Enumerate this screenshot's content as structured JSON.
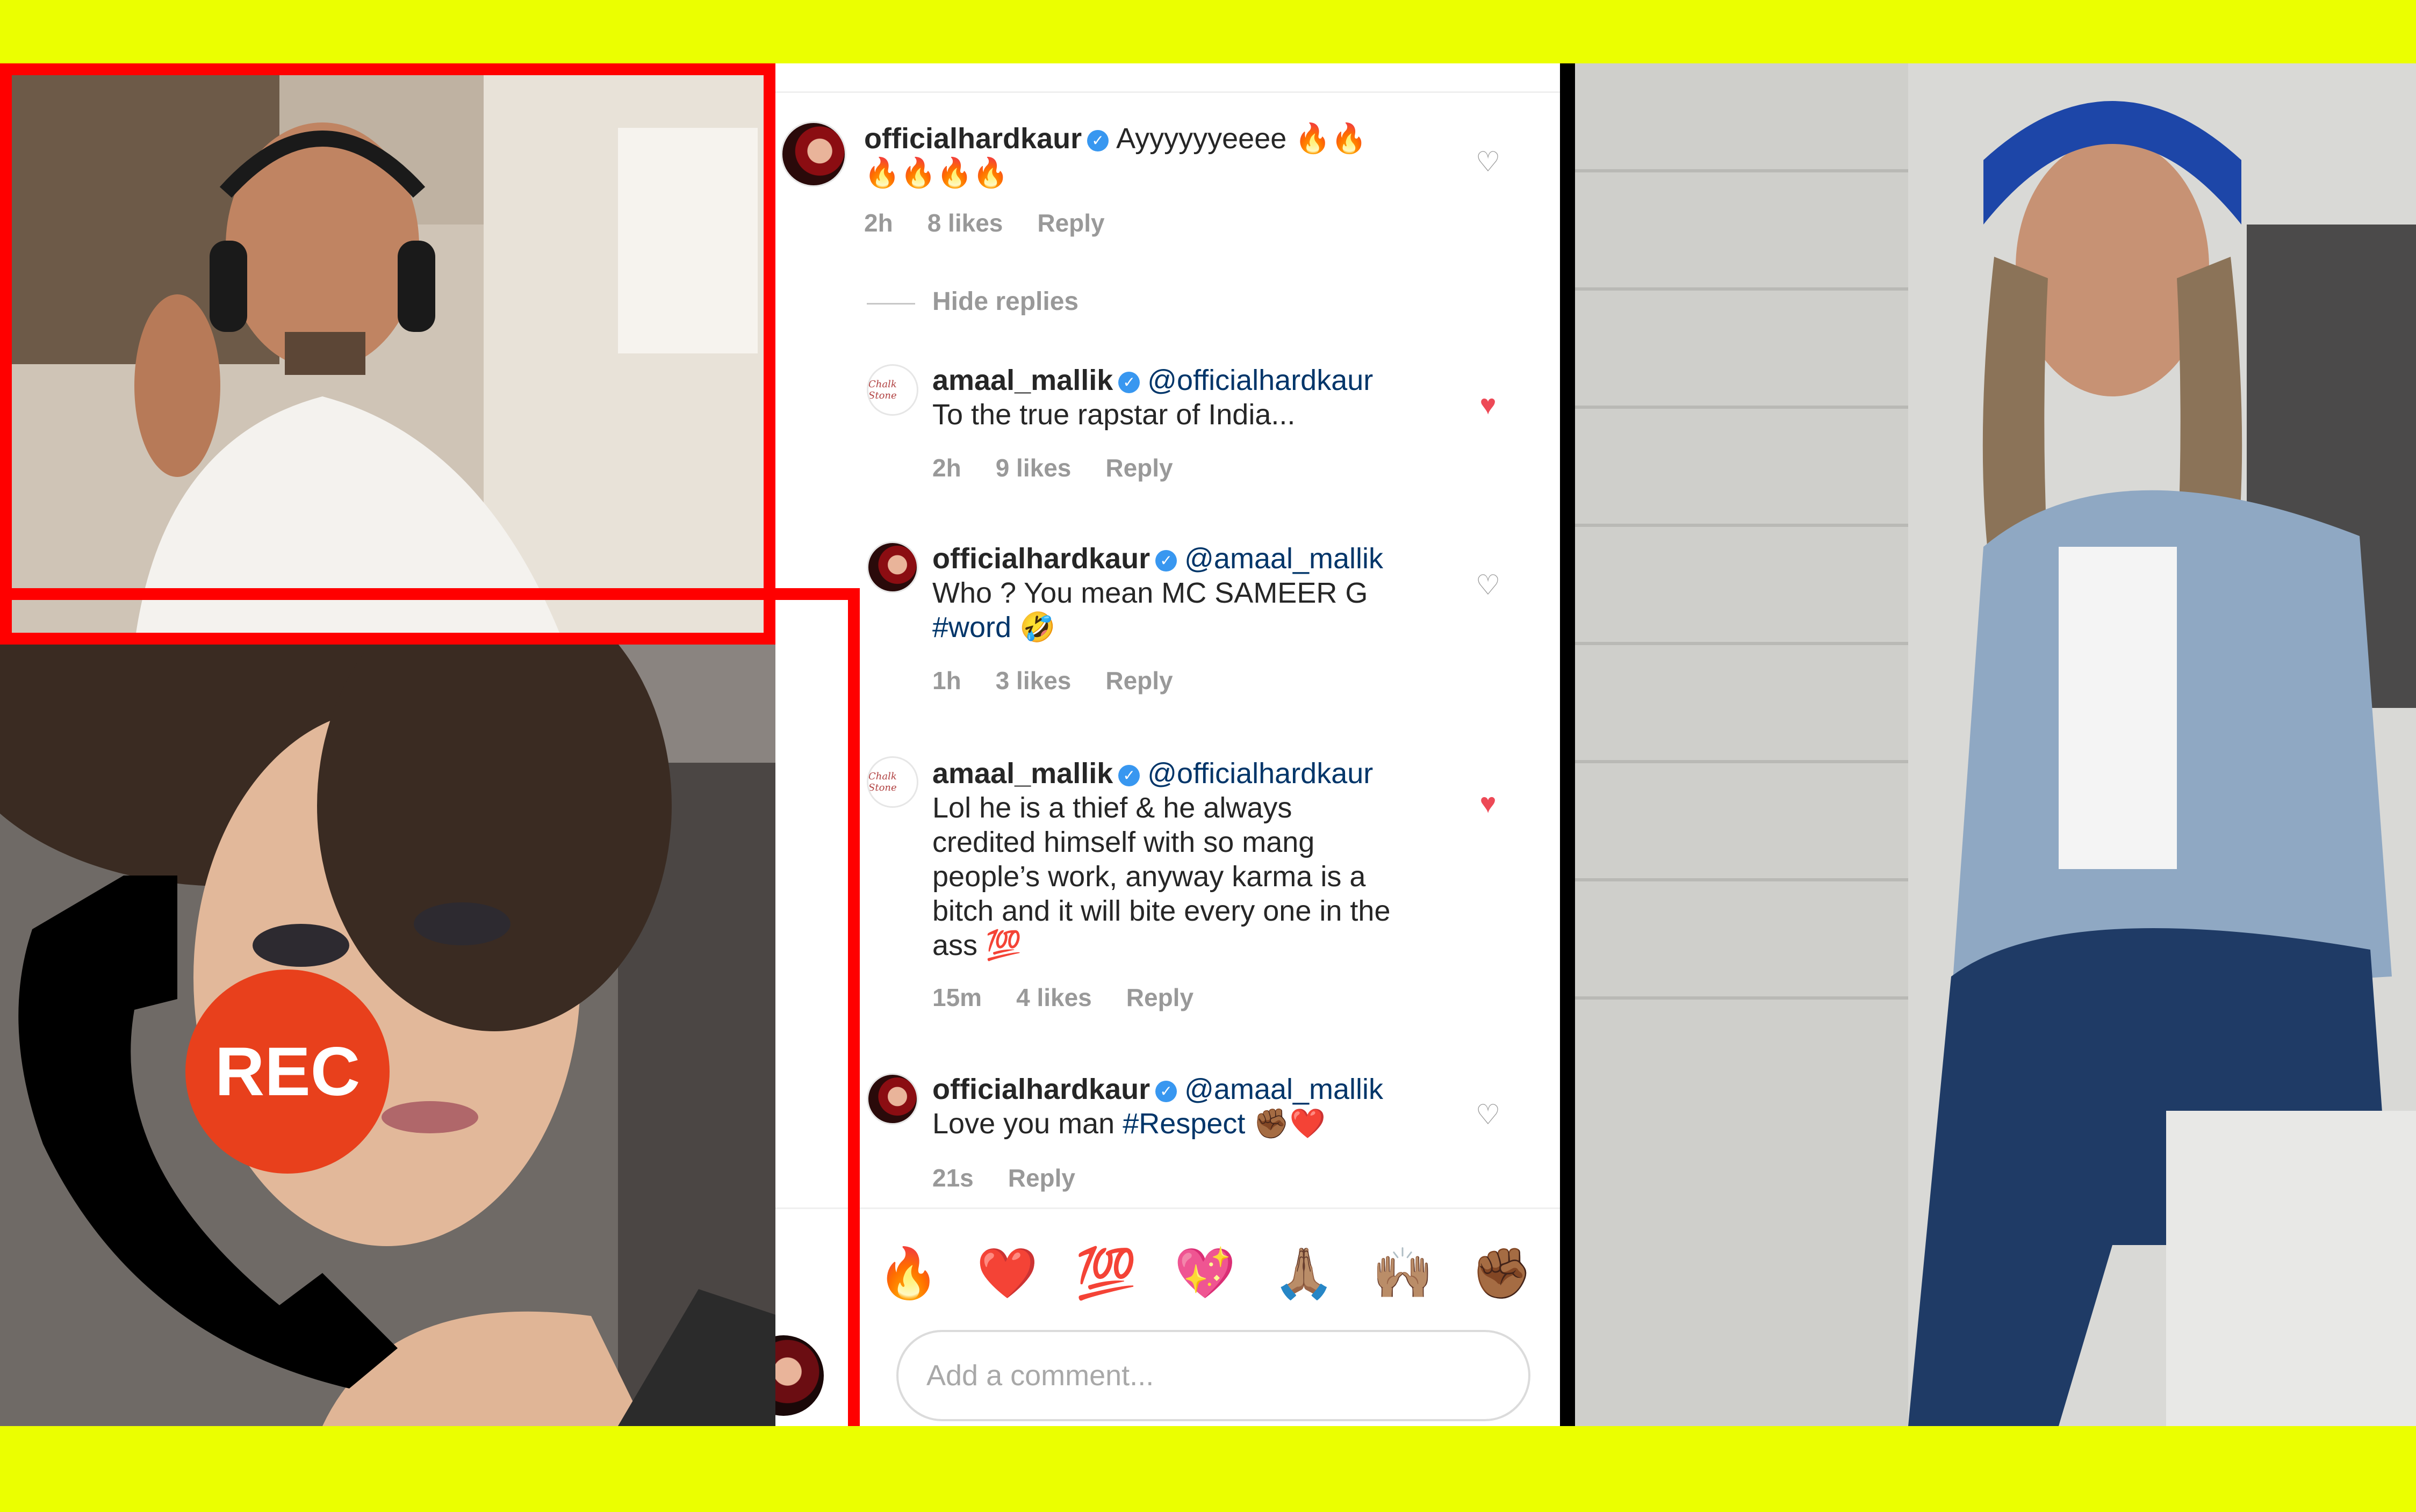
{
  "thread": {
    "comments": [
      {
        "user": "officialhardkaur",
        "verified": true,
        "mention": "",
        "text_line1": "Ayyyyyyeeee 🔥🔥",
        "text_line2": "🔥🔥🔥🔥",
        "time": "2h",
        "likes": "8 likes",
        "reply": "Reply",
        "liked": false
      },
      {
        "user": "amaal_mallik",
        "verified": true,
        "mention": "@officialhardkaur",
        "text_line1": "To the true rapstar of India...",
        "time": "2h",
        "likes": "9 likes",
        "reply": "Reply",
        "liked": true
      },
      {
        "user": "officialhardkaur",
        "verified": true,
        "mention": "@amaal_mallik",
        "text_line1": "Who ? You mean MC SAMEER G",
        "hashtag": "#word",
        "emoji": "🤣",
        "time": "1h",
        "likes": "3 likes",
        "reply": "Reply",
        "liked": false
      },
      {
        "user": "amaal_mallik",
        "verified": true,
        "mention": "@officialhardkaur",
        "text_line1": "Lol he is a thief & he always",
        "text_line2": "credited himself with so mang",
        "text_line3": "people’s work, anyway karma is a",
        "text_line4": "bitch and it will bite every one in the",
        "text_line5": "ass 💯",
        "time": "15m",
        "likes": "4 likes",
        "reply": "Reply",
        "liked": true
      },
      {
        "user": "officialhardkaur",
        "verified": true,
        "mention": "@amaal_mallik",
        "text_line1": "Love you man",
        "hashtag": "#Respect",
        "emoji": "✊🏾❤️",
        "time": "21s",
        "reply": "Reply",
        "liked": false
      }
    ],
    "hide_replies": "Hide replies",
    "avatar_amaal_text": "Chalk Stone"
  },
  "emoji_bar": [
    "🔥",
    "❤️",
    "💯",
    "💖",
    "🙏🏽",
    "🙌🏽",
    "✊🏾"
  ],
  "comment_input": {
    "placeholder": "Add a comment..."
  },
  "rec_badge": {
    "label": "REC"
  },
  "icons": {
    "verified": "verified-badge-icon",
    "heart_empty": "heart-outline-icon",
    "heart_full": "heart-filled-icon",
    "phone": "phone-handset-icon"
  },
  "colors": {
    "frame": "#ff0000",
    "background": "#ebff00",
    "verified": "#3897f0",
    "liked": "#ed4956",
    "rec": "#e8401c"
  }
}
